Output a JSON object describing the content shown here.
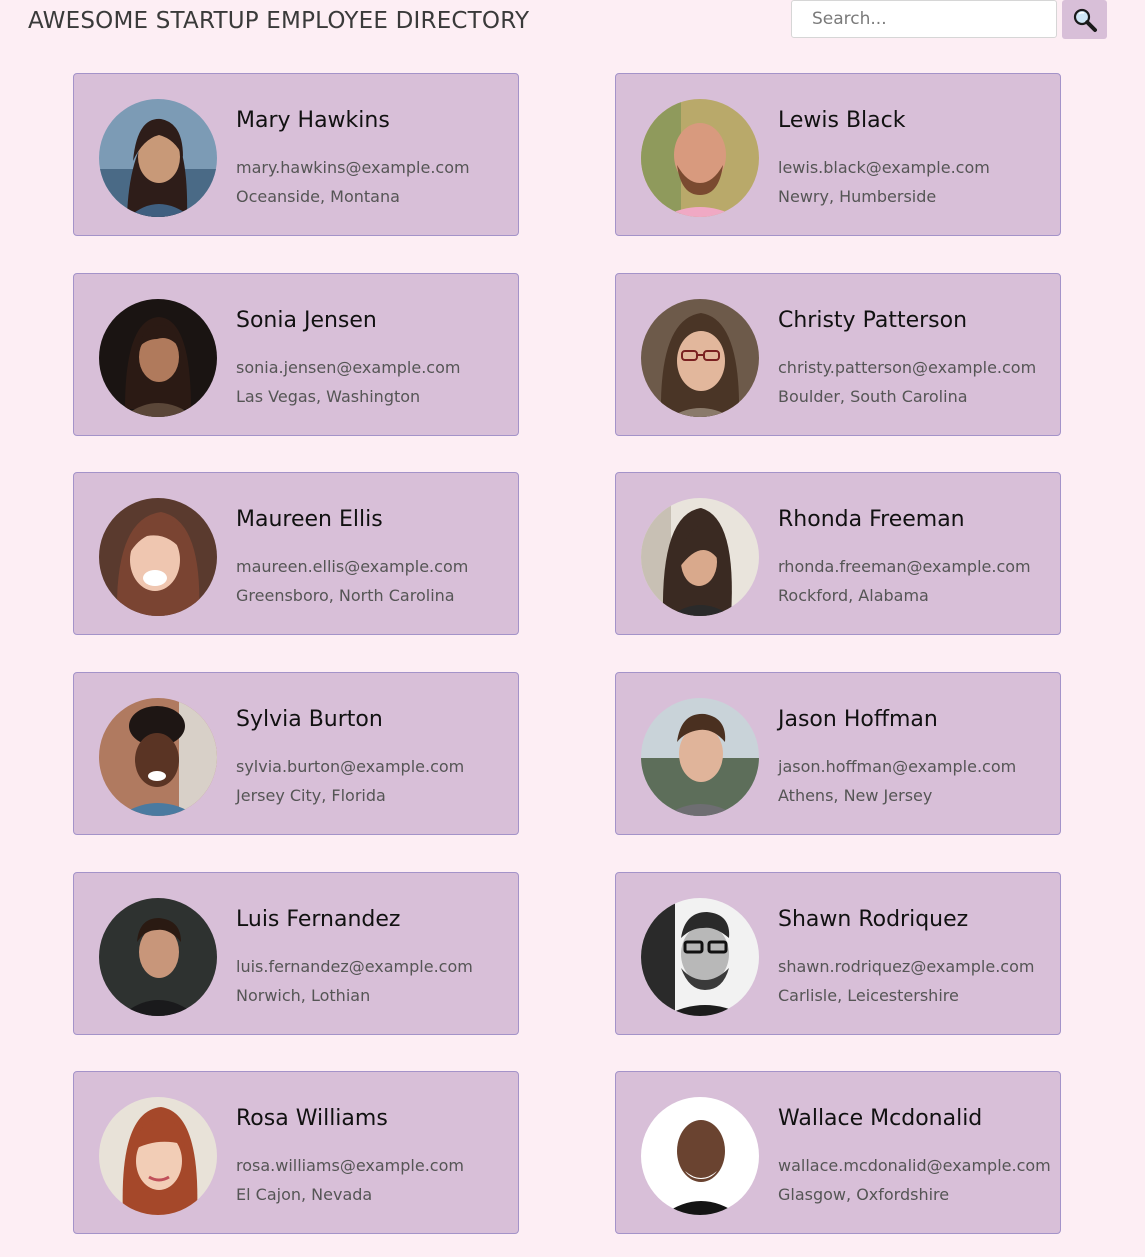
{
  "header": {
    "title": "AWESOME STARTUP EMPLOYEE DIRECTORY"
  },
  "search": {
    "placeholder": "Search...",
    "value": "",
    "button_icon": "magnifier-icon"
  },
  "colors": {
    "page_background": "#fdeef4",
    "card_background": "#d8bfd8",
    "card_border": "#a493c9"
  },
  "employees": [
    {
      "name": "Mary Hawkins",
      "email": "mary.hawkins@example.com",
      "location": "Oceanside, Montana"
    },
    {
      "name": "Lewis Black",
      "email": "lewis.black@example.com",
      "location": "Newry, Humberside"
    },
    {
      "name": "Sonia Jensen",
      "email": "sonia.jensen@example.com",
      "location": "Las Vegas, Washington"
    },
    {
      "name": "Christy Patterson",
      "email": "christy.patterson@example.com",
      "location": "Boulder, South Carolina"
    },
    {
      "name": "Maureen Ellis",
      "email": "maureen.ellis@example.com",
      "location": "Greensboro, North Carolina"
    },
    {
      "name": "Rhonda Freeman",
      "email": "rhonda.freeman@example.com",
      "location": "Rockford, Alabama"
    },
    {
      "name": "Sylvia Burton",
      "email": "sylvia.burton@example.com",
      "location": "Jersey City, Florida"
    },
    {
      "name": "Jason Hoffman",
      "email": "jason.hoffman@example.com",
      "location": "Athens, New Jersey"
    },
    {
      "name": "Luis Fernandez",
      "email": "luis.fernandez@example.com",
      "location": "Norwich, Lothian"
    },
    {
      "name": "Shawn Rodriquez",
      "email": "shawn.rodriquez@example.com",
      "location": "Carlisle, Leicestershire"
    },
    {
      "name": "Rosa Williams",
      "email": "rosa.williams@example.com",
      "location": "El Cajon, Nevada"
    },
    {
      "name": "Wallace Mcdonalid",
      "email": "wallace.mcdonalid@example.com",
      "location": "Glasgow, Oxfordshire"
    }
  ]
}
